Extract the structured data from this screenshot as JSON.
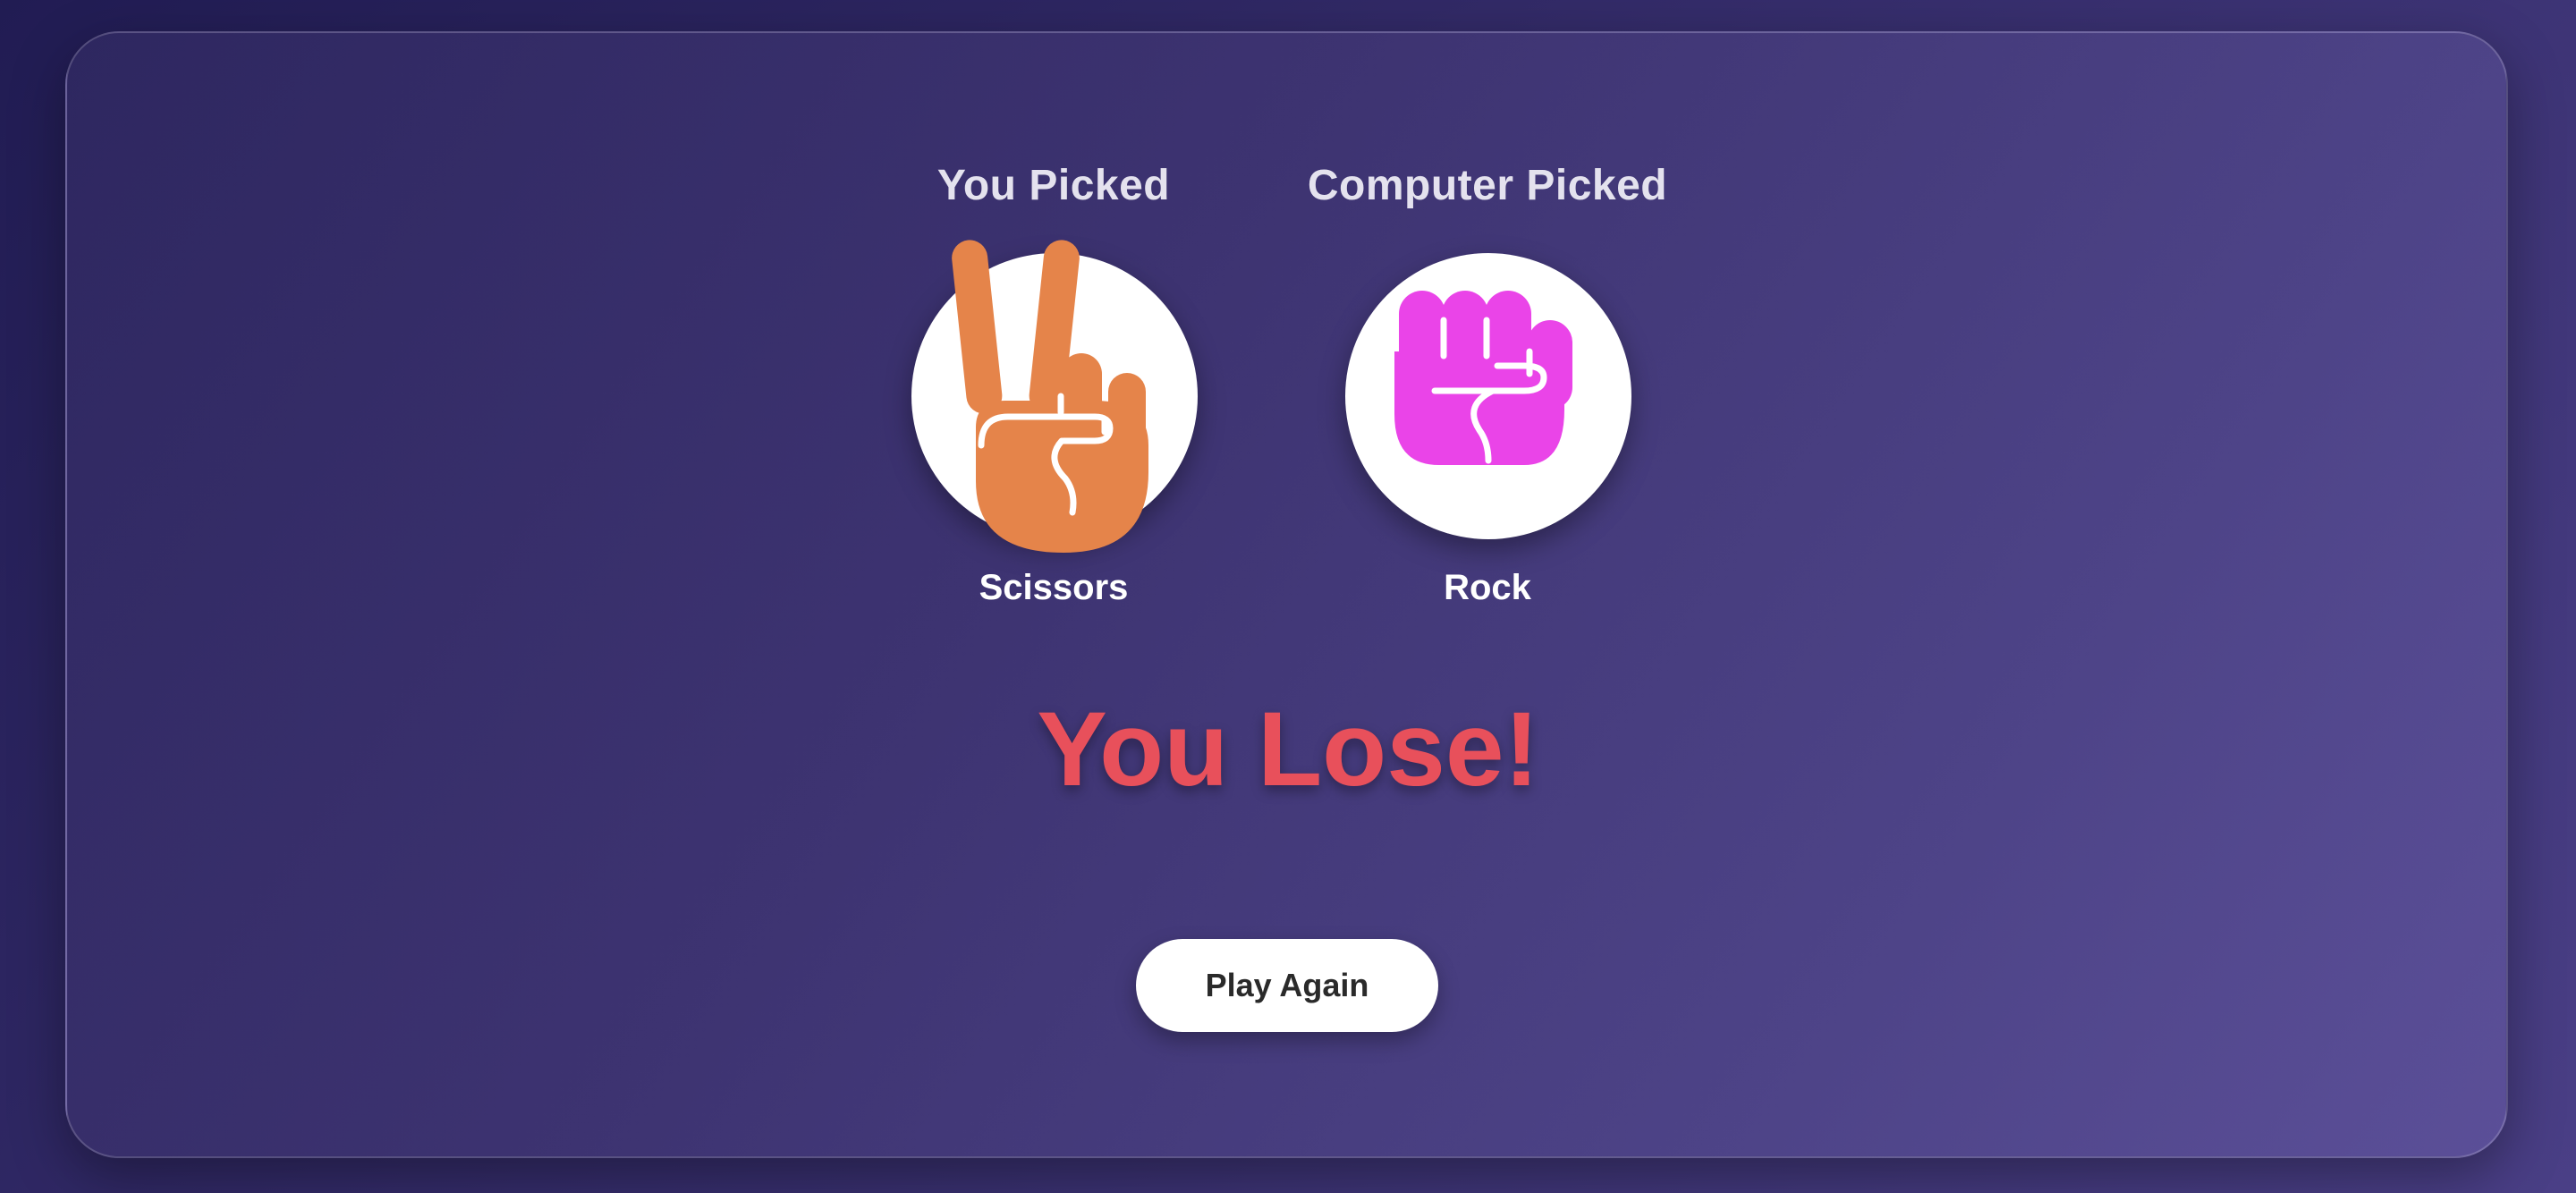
{
  "player": {
    "heading": "You Picked",
    "choice": "Scissors",
    "icon": "scissors-hand-icon",
    "color": "#e5844a"
  },
  "computer": {
    "heading": "Computer Picked",
    "choice": "Rock",
    "icon": "rock-fist-icon",
    "color": "#ea44e8"
  },
  "result": {
    "text": "You Lose!",
    "color": "#e8505b"
  },
  "actions": {
    "play_again_label": "Play Again"
  }
}
